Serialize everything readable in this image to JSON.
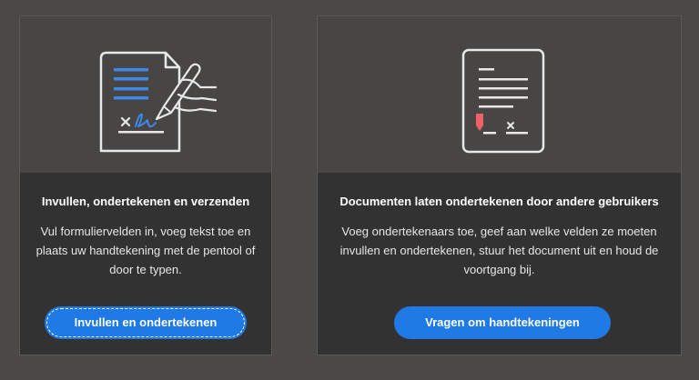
{
  "cards": [
    {
      "title": "Invullen, ondertekenen en verzenden",
      "description": "Vul formuliervelden in, voeg tekst toe en plaats uw handtekening met de pentool of door te typen.",
      "button_label": "Invullen en ondertekenen",
      "icon": "fill-and-sign-icon"
    },
    {
      "title": "Documenten laten ondertekenen door andere gebruikers",
      "description": "Voeg ondertekenaars toe, geef aan welke velden ze moeten invullen en ondertekenen, stuur het document uit en houd de voortgang bij.",
      "button_label": "Vragen om handtekeningen",
      "icon": "request-signatures-icon"
    }
  ],
  "colors": {
    "background": "#4a4947",
    "card": "#323232",
    "illustration": "#474645",
    "accent": "#1f7ae6",
    "icon_blue": "#3f87e8",
    "icon_red": "#f0606a"
  }
}
